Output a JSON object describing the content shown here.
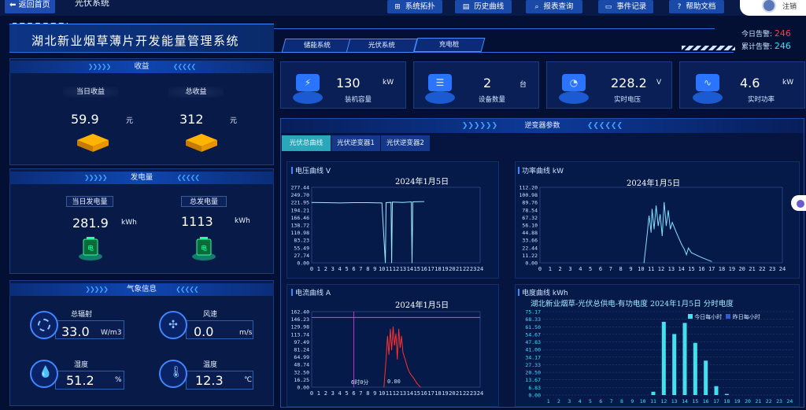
{
  "topnav": {
    "back_label": "返回首页",
    "system_title": "光伏系统",
    "buttons": [
      {
        "label": "系统拓扑",
        "icon": "topology-icon"
      },
      {
        "label": "历史曲线",
        "icon": "history-icon"
      },
      {
        "label": "报表查询",
        "icon": "search-icon"
      },
      {
        "label": "事件记录",
        "icon": "document-icon"
      },
      {
        "label": "帮助文档",
        "icon": "help-icon"
      }
    ],
    "logout_label": "注销"
  },
  "header": {
    "title": "湖北新业烟草薄片开发能量管理系统",
    "tabs": [
      "储能系统",
      "光伏系统",
      "充电桩"
    ],
    "today_alarm_label": "今日告警:",
    "today_alarm_value": "246",
    "total_alarm_label": "累计告警:",
    "total_alarm_value": "246",
    "today_color": "#ff3b3b",
    "total_color": "#19e6ff"
  },
  "revenue": {
    "title": "收益",
    "today_label": "当日收益",
    "today_value": "59.9",
    "today_unit": "元",
    "total_label": "总收益",
    "total_value": "312",
    "total_unit": "元"
  },
  "generation": {
    "title": "发电量",
    "today_label": "当日发电量",
    "today_value": "281.9",
    "today_unit": "kWh",
    "total_label": "总发电量",
    "total_value": "1113",
    "total_unit": "kWh"
  },
  "weather": {
    "title": "气象信息",
    "items": [
      {
        "label": "总辐射",
        "value": "33.0",
        "unit": "W/m3",
        "icon": "sun-icon"
      },
      {
        "label": "风速",
        "value": "0.0",
        "unit": "m/s",
        "icon": "fan-icon"
      },
      {
        "label": "湿度",
        "value": "51.2",
        "unit": "%",
        "icon": "humidity-icon"
      },
      {
        "label": "温度",
        "value": "12.3",
        "unit": "℃",
        "icon": "thermometer-icon"
      }
    ]
  },
  "kpis": [
    {
      "value": "130",
      "unit": "kW",
      "label": "装机容量",
      "icon": "solar-panel-icon"
    },
    {
      "value": "2",
      "unit": "台",
      "label": "设备数量",
      "icon": "server-icon"
    },
    {
      "value": "228.2",
      "unit": "V",
      "label": "实时电压",
      "icon": "gauge-icon"
    },
    {
      "value": "4.6",
      "unit": "kW",
      "label": "实时功率",
      "icon": "pulse-icon"
    }
  ],
  "inverter": {
    "title": "逆变器参数",
    "tabs": [
      "光伏总曲线",
      "光伏逆变器1",
      "光伏逆变器2"
    ],
    "active_tab": 0
  },
  "charts": {
    "voltage": {
      "title": "电压曲线",
      "unit": "V",
      "date": "2024年1月5日"
    },
    "power": {
      "title": "功率曲线",
      "unit": "kW",
      "date": "2024年1月5日"
    },
    "current": {
      "title": "电流曲线",
      "unit": "A",
      "date": "2024年1月5日",
      "cursor_label": "6时0分",
      "cursor_value": "0.00"
    },
    "energy": {
      "title": "电度曲线",
      "unit": "kWh",
      "heading": "湖北新业烟草-光伏总供电-有功电度 2024年1月5日 分时电度",
      "legend": [
        "今日每小时",
        "昨日每小时"
      ]
    }
  },
  "chart_data": [
    {
      "type": "line",
      "title": "2024年1月5日",
      "ylabel": "V",
      "x": [
        "0",
        "1",
        "2",
        "3",
        "4",
        "5",
        "6",
        "7",
        "8",
        "9",
        "10",
        "11",
        "12",
        "13",
        "14",
        "15",
        "16",
        "17",
        "18",
        "19",
        "20",
        "21",
        "22",
        "23",
        "24"
      ],
      "yticks": [
        "277.44",
        "249.70",
        "221.95",
        "194.21",
        "166.46",
        "138.72",
        "110.98",
        "83.23",
        "55.49",
        "27.74",
        "0.00"
      ],
      "ylim": [
        0,
        277.44
      ],
      "series": [
        {
          "values_description": "approx 222 V from hour 0 to 16, dips to 0 near hour 10.5, 11.4 and 14.3",
          "points": [
            [
              0,
              222
            ],
            [
              2,
              221
            ],
            [
              4,
              220
            ],
            [
              6,
              221
            ],
            [
              8,
              221
            ],
            [
              10,
              220
            ],
            [
              10.5,
              0
            ],
            [
              10.6,
              221
            ],
            [
              11.3,
              222
            ],
            [
              11.4,
              0
            ],
            [
              11.5,
              223
            ],
            [
              13,
              222
            ],
            [
              14.2,
              224
            ],
            [
              14.3,
              0
            ],
            [
              14.4,
              224
            ],
            [
              16,
              225
            ]
          ]
        }
      ]
    },
    {
      "type": "line",
      "title": "2024年1月5日",
      "ylabel": "kW",
      "x": [
        "0",
        "1",
        "2",
        "3",
        "4",
        "5",
        "6",
        "7",
        "8",
        "9",
        "10",
        "11",
        "12",
        "13",
        "14",
        "15",
        "16",
        "17",
        "18",
        "19",
        "20",
        "21",
        "22",
        "23",
        "24"
      ],
      "yticks": [
        "112.20",
        "100.98",
        "89.76",
        "78.54",
        "67.32",
        "56.10",
        "44.88",
        "33.66",
        "22.44",
        "11.22",
        "0.00"
      ],
      "ylim": [
        0,
        112.2
      ],
      "series": [
        {
          "points": [
            [
              10.3,
              0
            ],
            [
              10.6,
              40
            ],
            [
              10.8,
              70
            ],
            [
              11,
              45
            ],
            [
              11.1,
              80
            ],
            [
              11.3,
              50
            ],
            [
              11.5,
              85
            ],
            [
              11.7,
              55
            ],
            [
              11.9,
              72
            ],
            [
              12.1,
              40
            ],
            [
              12.3,
              90
            ],
            [
              12.5,
              55
            ],
            [
              12.7,
              78
            ],
            [
              12.9,
              50
            ],
            [
              13.1,
              60
            ],
            [
              13.5,
              45
            ],
            [
              14,
              28
            ],
            [
              14.3,
              20
            ],
            [
              14.5,
              12
            ],
            [
              14.7,
              22
            ],
            [
              15,
              15
            ],
            [
              16,
              8
            ],
            [
              17,
              2
            ]
          ]
        }
      ]
    },
    {
      "type": "line",
      "title": "2024年1月5日",
      "ylabel": "A",
      "x": [
        "0",
        "1",
        "2",
        "3",
        "4",
        "5",
        "6",
        "7",
        "8",
        "9",
        "10",
        "11",
        "12",
        "13",
        "14",
        "15",
        "16",
        "17",
        "18",
        "19",
        "20",
        "21",
        "22",
        "23",
        "24"
      ],
      "yticks": [
        "162.40",
        "146.23",
        "129.98",
        "113.74",
        "97.49",
        "81.24",
        "64.99",
        "48.74",
        "32.50",
        "16.25",
        "0.00"
      ],
      "ylim": [
        0,
        162.4
      ],
      "series": [
        {
          "points": [
            [
              10.3,
              0
            ],
            [
              10.6,
              60
            ],
            [
              10.8,
              110
            ],
            [
              11,
              70
            ],
            [
              11.2,
              125
            ],
            [
              11.4,
              80
            ],
            [
              11.6,
              130
            ],
            [
              11.8,
              90
            ],
            [
              12,
              115
            ],
            [
              12.2,
              60
            ],
            [
              12.4,
              125
            ],
            [
              12.6,
              85
            ],
            [
              12.8,
              110
            ],
            [
              13,
              75
            ],
            [
              13.3,
              60
            ],
            [
              13.7,
              40
            ],
            [
              14,
              30
            ],
            [
              14.5,
              20
            ],
            [
              15,
              8
            ],
            [
              15.5,
              0
            ]
          ]
        }
      ]
    },
    {
      "type": "bar",
      "title": "湖北新业烟草-光伏总供电-有功电度 2024年1月5日 分时电度",
      "categories": [
        "1",
        "2",
        "3",
        "4",
        "5",
        "6",
        "7",
        "8",
        "9",
        "10",
        "11",
        "12",
        "13",
        "14",
        "15",
        "16",
        "17",
        "18",
        "19",
        "20",
        "21",
        "22",
        "23",
        "24"
      ],
      "yticks": [
        "75.17",
        "68.33",
        "61.50",
        "54.67",
        "47.83",
        "41.00",
        "34.17",
        "27.33",
        "20.50",
        "13.67",
        "6.83",
        "0.00"
      ],
      "ylim": [
        0,
        75.17
      ],
      "series": [
        {
          "name": "今日每小时",
          "values": [
            0,
            0,
            0,
            0,
            0,
            0,
            0,
            0,
            0,
            0,
            3,
            66,
            55,
            65,
            47,
            31,
            8,
            1,
            0,
            0,
            0,
            0,
            0,
            0
          ]
        },
        {
          "name": "昨日每小时",
          "values": []
        }
      ]
    }
  ]
}
